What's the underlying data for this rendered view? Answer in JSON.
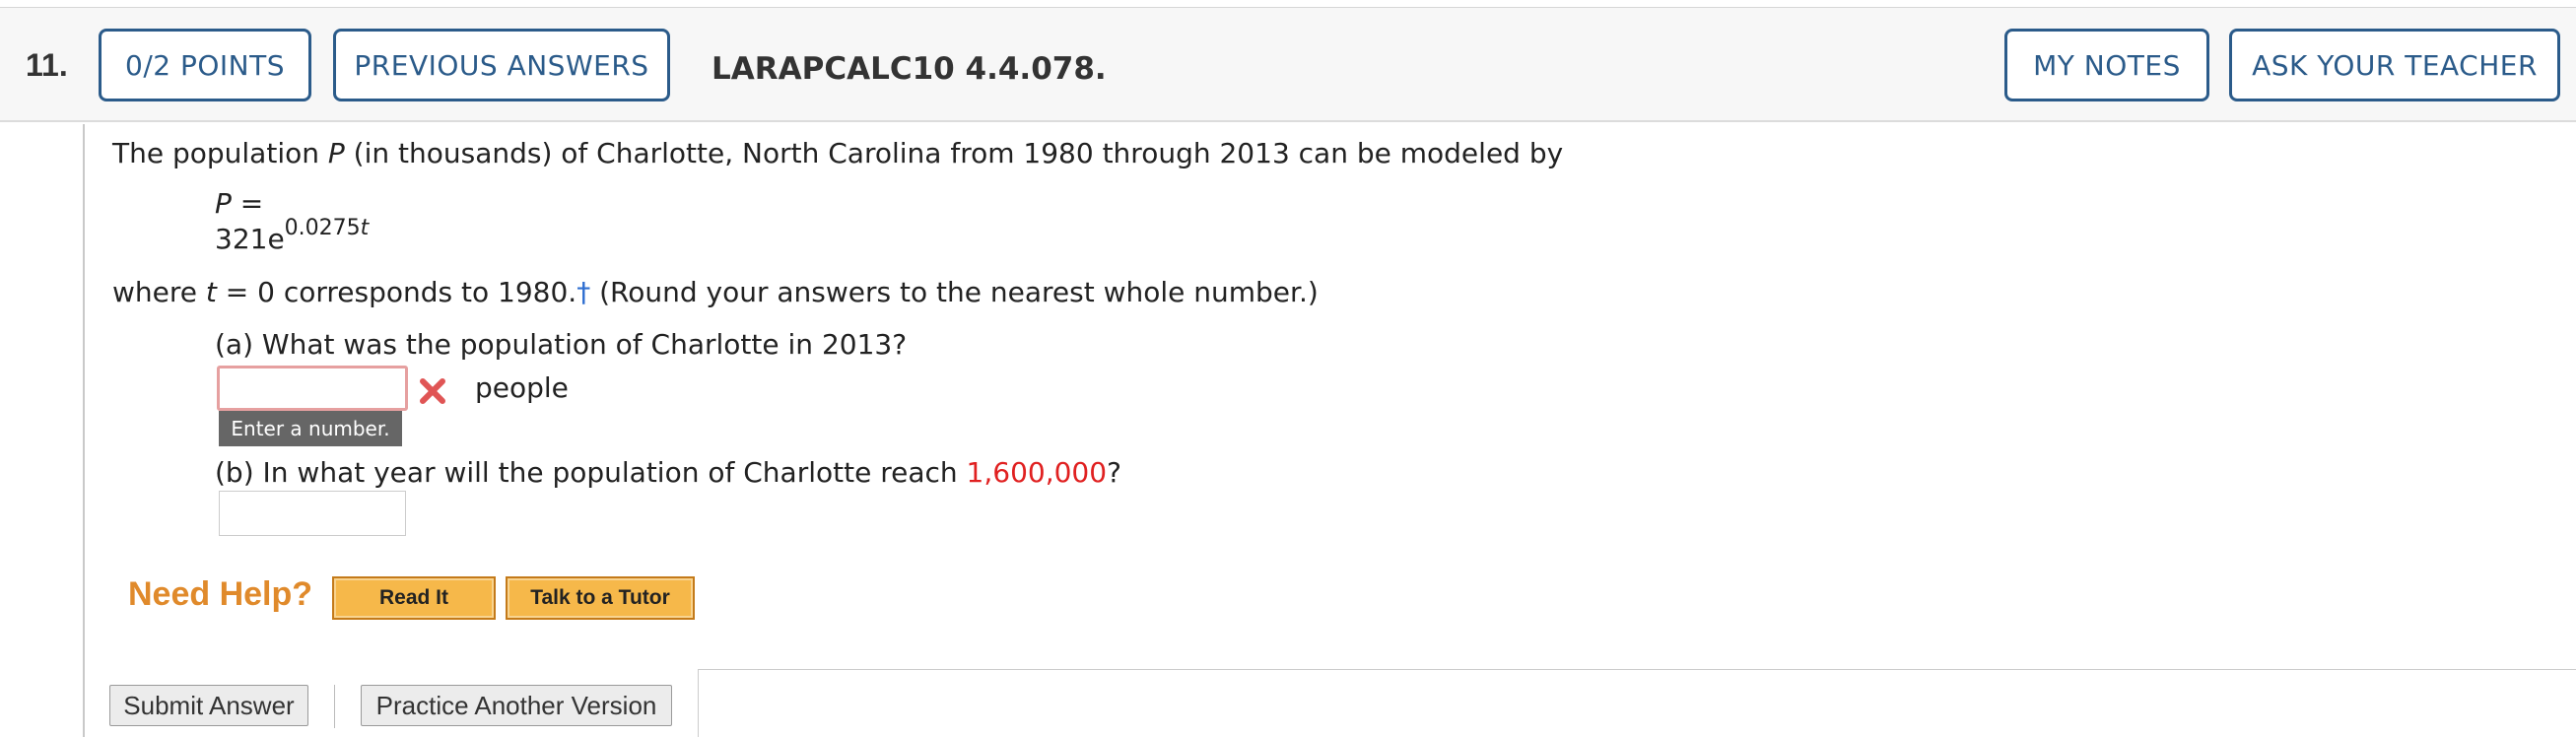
{
  "header": {
    "question_number": "11.",
    "points_label": "0/2 POINTS",
    "previous_answers_label": "PREVIOUS ANSWERS",
    "question_code": "LARAPCALC10 4.4.078.",
    "my_notes_label": "MY NOTES",
    "ask_teacher_label": "ASK YOUR TEACHER"
  },
  "problem": {
    "intro_1": "The population ",
    "intro_var": "P",
    "intro_2": " (in thousands) of Charlotte, North Carolina from 1980 through 2013 can be modeled by",
    "eq_lhs_var": "P",
    "eq_lhs_rest": " =",
    "eq_base": "321e",
    "eq_exp_num": "0.0275",
    "eq_exp_var": "t",
    "where_1": "where ",
    "where_var": "t",
    "where_2": " = 0 corresponds to 1980.",
    "dagger": "†",
    "where_3": " (Round your answers to the nearest whole number.)"
  },
  "part_a": {
    "question": "(a) What was the population of Charlotte in 2013?",
    "answer_value": "",
    "unit": "people",
    "status": "incorrect",
    "tooltip": "Enter a number."
  },
  "part_b": {
    "question_1": "(b) In what year will the population of Charlotte reach ",
    "highlight": "1,600,000",
    "question_2": "?",
    "answer_value": ""
  },
  "help": {
    "label": "Need Help?",
    "read_it": "Read It",
    "talk_to_tutor": "Talk to a Tutor"
  },
  "actions": {
    "submit": "Submit Answer",
    "practice": "Practice Another Version"
  },
  "colors": {
    "accent": "#2b5b8a",
    "error": "#e02020",
    "help": "#e08a2b",
    "help_button": "#f6b84a",
    "dagger": "#2f6fd1"
  },
  "icons": {
    "status_a": "x-mark-icon"
  }
}
